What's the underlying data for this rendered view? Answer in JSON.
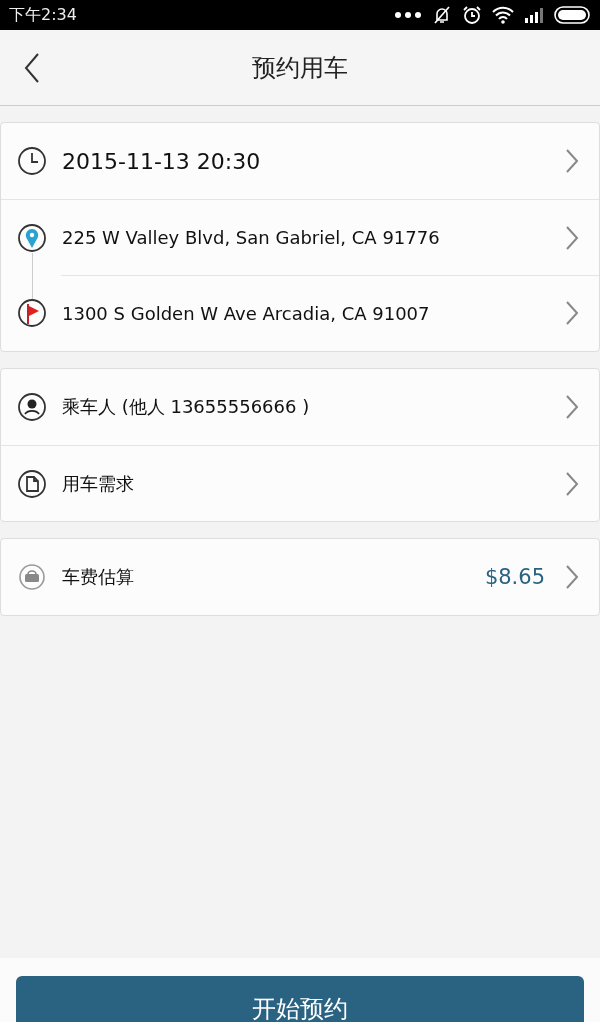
{
  "status_bar": {
    "time": "下午2:34"
  },
  "header": {
    "title": "预约用车"
  },
  "groups": [
    {
      "rows": [
        {
          "kind": "time",
          "text": "2015-11-13 20:30"
        },
        {
          "kind": "start",
          "text": "225 W Valley Blvd, San Gabriel, CA 91776"
        },
        {
          "kind": "end",
          "text": "1300 S Golden W Ave Arcadia, CA 91007"
        }
      ]
    },
    {
      "rows": [
        {
          "kind": "passenger",
          "text": "乘车人 (他人 13655556666 )"
        },
        {
          "kind": "request",
          "text": "用车需求"
        }
      ]
    },
    {
      "rows": [
        {
          "kind": "fare",
          "text": "车费估算",
          "value": "$8.65"
        }
      ]
    }
  ],
  "button": {
    "label": "开始预约"
  }
}
